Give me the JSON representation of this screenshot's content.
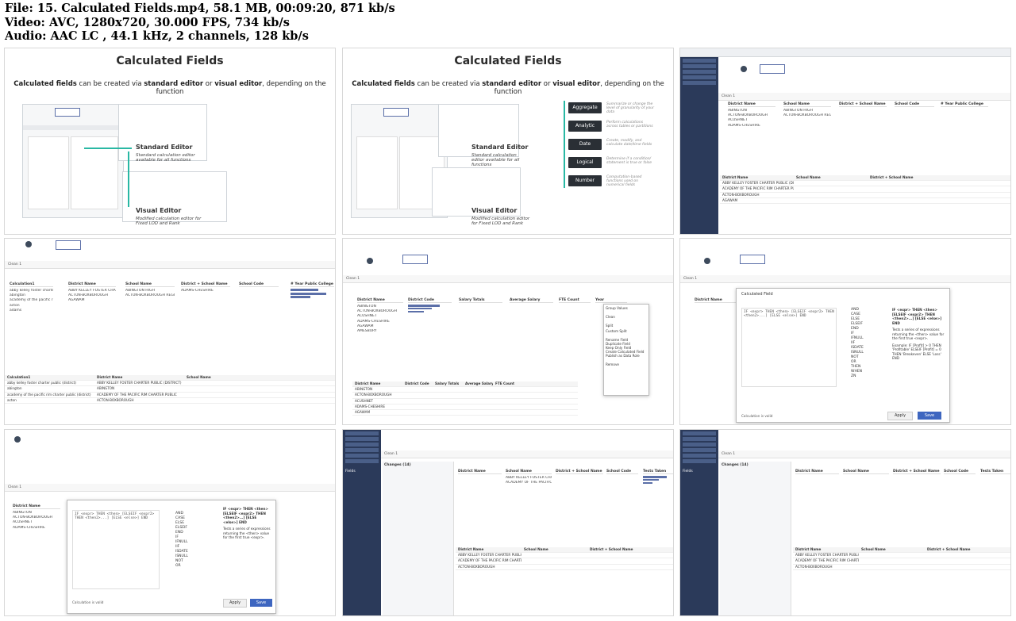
{
  "meta": {
    "file": "File: 15. Calculated Fields.mp4, 58.1 MB, 00:09:20, 871 kb/s",
    "video": "Video: AVC, 1280x720, 30.000 FPS, 734 kb/s",
    "audio": "Audio: AAC LC , 44.1 kHz, 2 channels, 128 kb/s"
  },
  "slide": {
    "title": "Calculated Fields",
    "subtitle_a": "Calculated fields",
    "subtitle_b": " can be created via ",
    "subtitle_c": "standard editor",
    "subtitle_d": " or ",
    "subtitle_e": "visual editor",
    "subtitle_f": ", depending on the function",
    "standard_editor": "Standard Editor",
    "standard_desc": "Standard calculation editor available for all functions",
    "visual_editor": "Visual Editor",
    "visual_desc": "Modified calculation editor for Fixed LOD and Rank",
    "functions": [
      {
        "label": "Aggregate",
        "desc": "Summarize or change the level of granularity of your data"
      },
      {
        "label": "Analytic",
        "desc": "Perform calculations across tables or partitions"
      },
      {
        "label": "Date",
        "desc": "Create, modify, and calculate date/time fields"
      },
      {
        "label": "Logical",
        "desc": "Determine if a condition/ statement is true or false"
      },
      {
        "label": "Number",
        "desc": "Computation-based functions used on numerical fields"
      }
    ]
  },
  "app": {
    "clean_label": "Clean 1",
    "columns_a": [
      "Calculation1",
      "District Name",
      "School Name",
      "District + School Name",
      "School Code",
      "# Year Public College"
    ],
    "columns_b": [
      "District Name",
      "District Code",
      "Salary Totals",
      "Average Salary",
      "FTE Count",
      "Year"
    ],
    "columns_c": [
      "District Name",
      "School Name",
      "District + School Name",
      "School Code",
      "Tests Taken"
    ],
    "rows_a": [
      "abby kelley foster charter public (district)",
      "abington",
      "academy of the pacific rim charter public (district)",
      "acton",
      "adams",
      "advanced math and science academy charter (district)"
    ],
    "rows_b": [
      "ABINGTON",
      "ACTON-BOXBOROUGH",
      "ACUSHNET",
      "ADAMS-CHESHIRE",
      "AGAWAM",
      "AMESBURY",
      "AMHERST",
      "AMHERST-PELHAM"
    ],
    "schools": [
      "ABBY KELLEY FOSTER CHARTER PUBLIC (DISTRICT)",
      "ABINGTON HIGH",
      "ACADEMY OF THE PACIFIC RIM CHARTER PUBLIC",
      "ACTON-BOXBOROUGH REGIONAL HIGH",
      "ADAMS-CHESHIRE",
      "ADVANCED MATH AND SCIENCE ACADEMY"
    ],
    "popup_menu": [
      "Group Values",
      "Clean",
      "Split",
      "Custom Split",
      "Rename Field",
      "Duplicate Field",
      "Keep Only Field",
      "Create Calculated Field",
      "Publish as Data Role",
      "Remove"
    ],
    "calc_title": "Calculated Field",
    "calc_code": "IF <expr> THEN <then> [ELSEIF <expr2> THEN <then2>...] [ELSE <else>] END",
    "calc_desc": "Tests a series of expressions returning the <then> value for the first true <expr>.",
    "calc_example": "Example: IF [Profit] > 0 THEN 'Profitable' ELSEIF [Profit] = 0 THEN 'Breakeven' ELSE 'Loss' END",
    "functions_list": [
      "AND",
      "CASE",
      "ELSE",
      "ELSEIF",
      "END",
      "IF",
      "IFNULL",
      "IIF",
      "ISDATE",
      "ISNULL",
      "NOT",
      "OR",
      "THEN",
      "WHEN",
      "ZN"
    ],
    "apply_label": "Apply",
    "save_label": "Save",
    "changes_label": "Changes (14)",
    "fields_label": "Fields",
    "calc_valid": "Calculation is valid"
  }
}
